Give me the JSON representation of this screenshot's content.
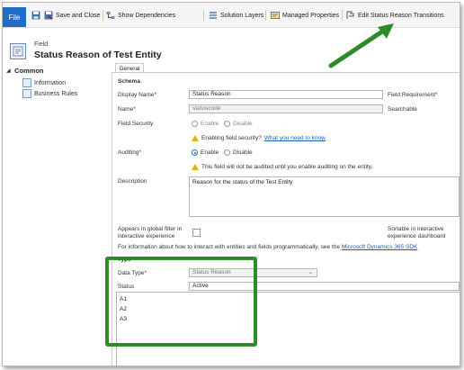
{
  "ribbon": {
    "file_label": "File",
    "buttons": [
      {
        "label": "",
        "icon": "save-icon"
      },
      {
        "label": "Save and Close",
        "icon": "save-close-icon"
      },
      {
        "label": "Show Dependencies",
        "icon": "dependencies-icon"
      },
      {
        "label": "Solution Layers",
        "icon": "layers-icon"
      },
      {
        "label": "Managed Properties",
        "icon": "managed-properties-icon"
      },
      {
        "label": "Edit Status Reason Transitions",
        "icon": "transitions-icon"
      }
    ]
  },
  "header": {
    "field_label": "Field",
    "title": "Status Reason of Test Entity"
  },
  "tab": {
    "label": "General"
  },
  "nav": {
    "heading": "Common",
    "items": [
      {
        "label": "Information"
      },
      {
        "label": "Business Rules"
      }
    ]
  },
  "schema": {
    "heading": "Schema",
    "display_name_label": "Display Name",
    "display_name_value": "Status Reason",
    "field_requirement_label": "Field Requirement",
    "name_label": "Name",
    "name_value": "statuscode",
    "searchable_label": "Searchable",
    "field_security_label": "Field Security",
    "fs_enable": "Enable",
    "fs_disable": "Disable",
    "fs_note": "Enabling field security?",
    "fs_link": "What you need to know",
    "auditing_label": "Auditing",
    "audit_enable": "Enable",
    "audit_disable": "Disable",
    "audit_note": "This field will not be audited until you enable auditing on the entity.",
    "description_label": "Description",
    "description_value": "Reason for the status of the Test Entity",
    "global_filter_label_1": "Appears in global filter in",
    "global_filter_label_2": "interactive experience",
    "sortable_label_1": "Sortable in interactive",
    "sortable_label_2": "experience dashboard",
    "info_text": "For information about how to interact with entities and fields programmatically, see the",
    "info_link": "Microsoft Dynamics 365 SDK"
  },
  "type_section": {
    "heading": "Type",
    "data_type_label": "Data Type",
    "data_type_value": "Status Reason",
    "status_label": "Status",
    "status_value": "Active",
    "options": [
      "A1",
      "A2",
      "A3"
    ]
  },
  "colors": {
    "file_button": "#1f6dc6",
    "highlight": "#2f8a2a",
    "link": "#1a5fb4"
  }
}
